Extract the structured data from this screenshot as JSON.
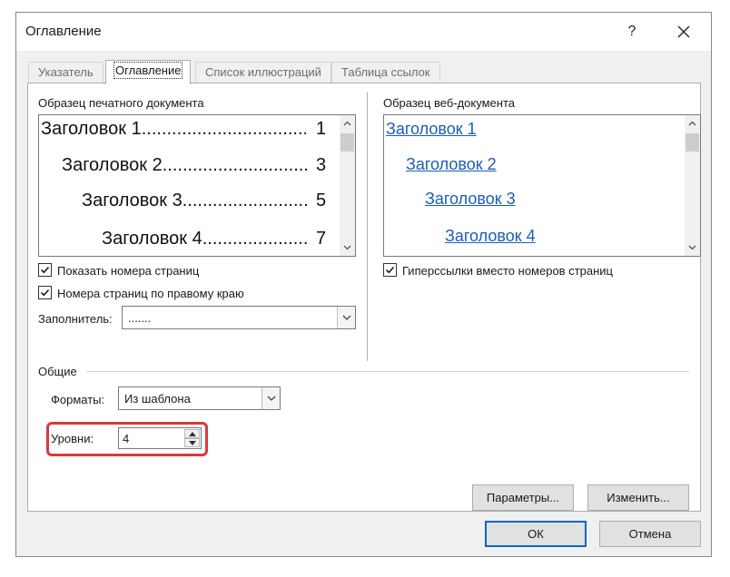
{
  "window": {
    "title": "Оглавление",
    "help": "?"
  },
  "tabs": [
    {
      "label": "Указатель",
      "active": false
    },
    {
      "label": "Оглавление",
      "active": true
    },
    {
      "label": "Список иллюстраций",
      "active": false
    },
    {
      "label": "Таблица ссылок",
      "active": false
    }
  ],
  "print_preview": {
    "label": "Образец печатного документа",
    "lines": [
      {
        "text": "Заголовок 1",
        "page": "1"
      },
      {
        "text": "Заголовок 2",
        "page": "3"
      },
      {
        "text": "Заголовок 3",
        "page": "5"
      },
      {
        "text": "Заголовок 4",
        "page": "7"
      }
    ]
  },
  "web_preview": {
    "label": "Образец веб-документа",
    "links": [
      "Заголовок 1",
      "Заголовок 2",
      "Заголовок 3",
      "Заголовок 4"
    ]
  },
  "options": {
    "show_page_numbers": {
      "label": "Показать номера страниц",
      "checked": true
    },
    "right_align": {
      "label": "Номера страниц по правому краю",
      "checked": true
    },
    "hyperlinks": {
      "label": "Гиперссылки вместо номеров страниц",
      "checked": true
    },
    "tab_leader_label": "Заполнитель:",
    "tab_leader_value": "......."
  },
  "general": {
    "title": "Общие",
    "formats_label": "Форматы:",
    "formats_value": "Из шаблона",
    "levels_label": "Уровни:",
    "levels_value": "4"
  },
  "buttons": {
    "params": "Параметры...",
    "modify": "Изменить...",
    "ok": "ОК",
    "cancel": "Отмена"
  },
  "colors": {
    "link": "#1a5fb4",
    "highlight": "#d63a3a",
    "default_button_border": "#0a64c8"
  }
}
